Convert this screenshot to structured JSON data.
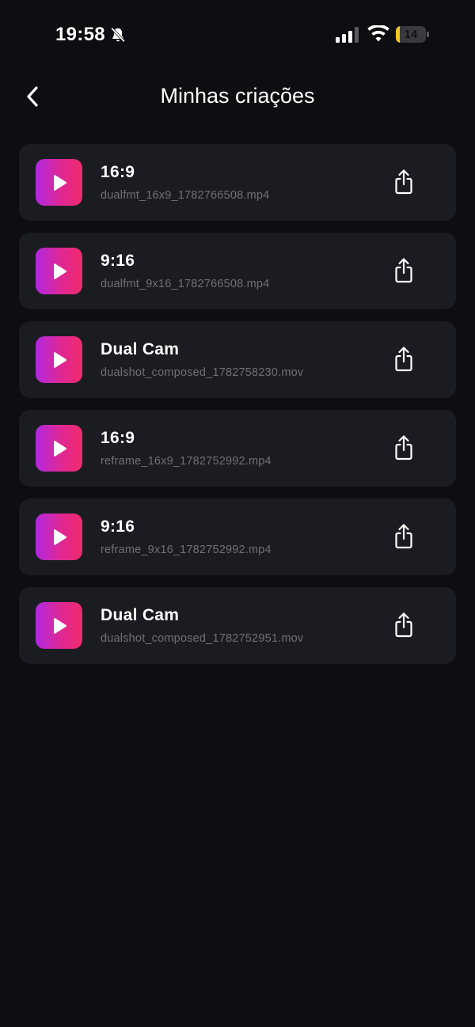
{
  "status_bar": {
    "time": "19:58",
    "battery_level": "14",
    "battery_fraction": 0.14
  },
  "header": {
    "title": "Minhas criações",
    "back_icon": "chevron-left-icon"
  },
  "creations": [
    {
      "title": "16:9",
      "file": "dualfmt_16x9_1782766508.mp4"
    },
    {
      "title": "9:16",
      "file": "dualfmt_9x16_1782766508.mp4"
    },
    {
      "title": "Dual Cam",
      "file": "dualshot_composed_1782758230.mov"
    },
    {
      "title": "16:9",
      "file": "reframe_16x9_1782752992.mp4"
    },
    {
      "title": "9:16",
      "file": "reframe_9x16_1782752992.mp4"
    },
    {
      "title": "Dual Cam",
      "file": "dualshot_composed_1782752951.mov"
    }
  ],
  "icons": {
    "thumbnail": "play-icon",
    "action": "share-icon"
  },
  "colors": {
    "background": "#0e0e12",
    "card": "#1b1c21",
    "gradient_start": "#b028e0",
    "gradient_end": "#f12a6c",
    "secondary_text": "#6f7078",
    "battery": "#f3c623"
  }
}
